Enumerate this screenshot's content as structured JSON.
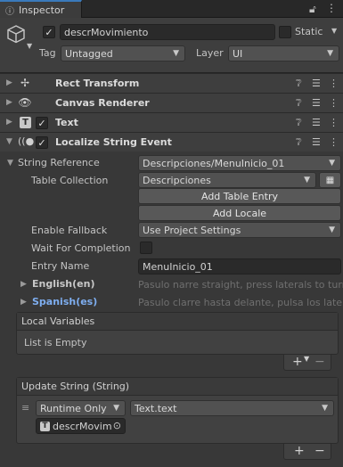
{
  "window": {
    "tab_title": "Inspector"
  },
  "header": {
    "object_name": "descrMovimiento",
    "static_label": "Static",
    "tag_label": "Tag",
    "tag_value": "Untagged",
    "layer_label": "Layer",
    "layer_value": "UI"
  },
  "components": [
    {
      "title": "Rect Transform"
    },
    {
      "title": "Canvas Renderer"
    },
    {
      "title": "Text"
    },
    {
      "title": "Localize String Event"
    }
  ],
  "localize": {
    "string_reference_label": "String Reference",
    "string_reference_value": "Descripciones/MenuInicio_01",
    "table_collection_label": "Table Collection",
    "table_collection_value": "Descripciones",
    "add_table_entry": "Add Table Entry",
    "add_locale": "Add Locale",
    "enable_fallback_label": "Enable Fallback",
    "enable_fallback_value": "Use Project Settings",
    "wait_for_completion_label": "Wait For Completion",
    "entry_name_label": "Entry Name",
    "entry_name_value": "MenuInicio_01",
    "locales": [
      {
        "name": "English(en)",
        "preview": "Pasulo narre straight, press laterals to turn"
      },
      {
        "name": "Spanish(es)",
        "preview": "Pasulo clarre hasta delante, pulsa los laterales"
      }
    ]
  },
  "local_variables": {
    "title": "Local Variables",
    "empty_text": "List is Empty"
  },
  "update_string": {
    "title": "Update String (String)",
    "mode_value": "Runtime Only",
    "function_value": "Text.text",
    "target_value": "descrMovim"
  },
  "colors": {
    "accent": "#3a79bb",
    "spanish_label": "#7eaef0"
  }
}
